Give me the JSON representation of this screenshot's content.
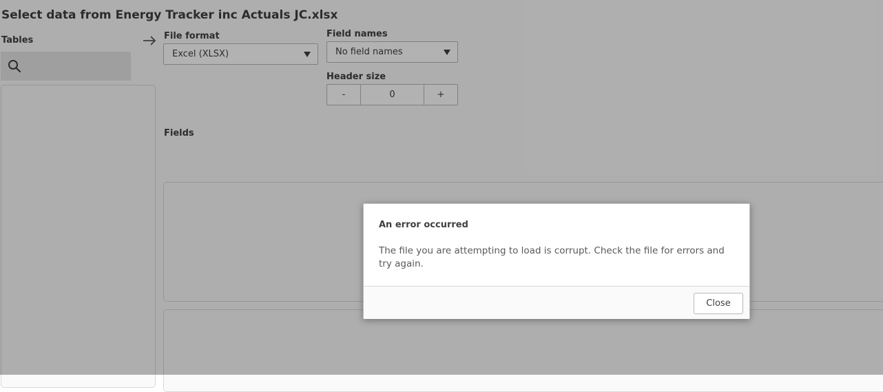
{
  "page_title": "Select data from Energy Tracker inc Actuals JC.xlsx",
  "tables": {
    "label": "Tables",
    "search_icon": "search-icon"
  },
  "arrow_icon": "arrow-right-icon",
  "file_format": {
    "label": "File format",
    "value": "Excel (XLSX)"
  },
  "field_names": {
    "label": "Field names",
    "value": "No field names"
  },
  "header_size": {
    "label": "Header size",
    "decrement": "-",
    "value": "0",
    "increment": "+"
  },
  "fields_label": "Fields",
  "dialog": {
    "title": "An error occurred",
    "message": "The file you are attempting to load is corrupt. Check the file for errors and try again.",
    "close_label": "Close"
  }
}
